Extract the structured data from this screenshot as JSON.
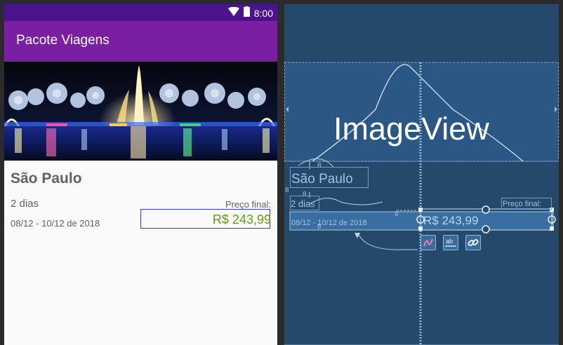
{
  "status_bar": {
    "time": "8:00"
  },
  "app_bar": {
    "title": "Pacote Viagens"
  },
  "package": {
    "city": "São Paulo",
    "days": "2 dias",
    "dates": "08/12 - 10/12 de 2018",
    "price_label": "Preço final:",
    "price": "R$ 243,99"
  },
  "blueprint": {
    "image_view_label": "ImageView",
    "city": "São Paulo",
    "days": "2 dias",
    "dates": "08/12 - 10/12 de 2018",
    "price_label": "Preço final:",
    "price": "R$ 243,99",
    "margin_marks": [
      "8",
      "8",
      "8",
      "8",
      "8"
    ]
  },
  "colors": {
    "status_bar": "#4a148c",
    "app_bar": "#7b1fa2",
    "price_text": "#5f9f0f",
    "blueprint_bg": "#24496b"
  }
}
